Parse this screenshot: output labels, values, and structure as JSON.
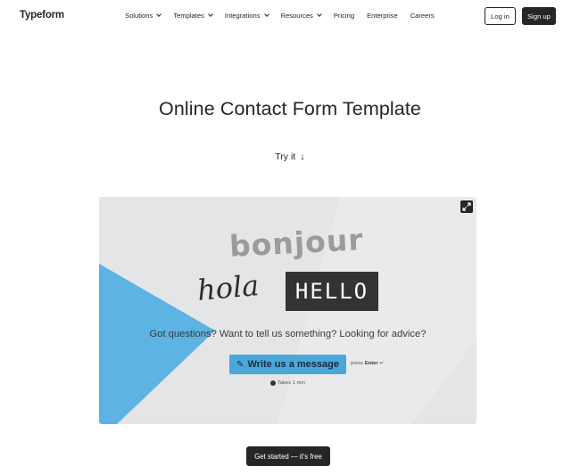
{
  "header": {
    "logo": "Typeform",
    "menu": [
      {
        "label": "Solutions",
        "has_dropdown": true
      },
      {
        "label": "Templates",
        "has_dropdown": true
      },
      {
        "label": "Integrations",
        "has_dropdown": true
      },
      {
        "label": "Resources",
        "has_dropdown": true
      },
      {
        "label": "Pricing",
        "has_dropdown": false
      },
      {
        "label": "Enterprise",
        "has_dropdown": false
      },
      {
        "label": "Careers",
        "has_dropdown": false
      }
    ],
    "login_label": "Log in",
    "signup_label": "Sign up"
  },
  "hero": {
    "title": "Online Contact Form Template",
    "try_label": "Try it",
    "try_arrow": "↓"
  },
  "preview": {
    "word_bonjour": "bonjour",
    "word_hola": "hola",
    "word_hello": "HELLO",
    "question": "Got questions? Want to tell us something? Looking for advice?",
    "cta_icon": "✎",
    "cta_label": "Write us a message",
    "press_label": "press",
    "press_key": "Enter",
    "press_symbol": "↵",
    "takes_label": "Takes 1 min",
    "accent_color": "#5db3e3",
    "button_color": "#4aa8d8"
  },
  "footer_cta": {
    "label": "Get started — it's free"
  }
}
